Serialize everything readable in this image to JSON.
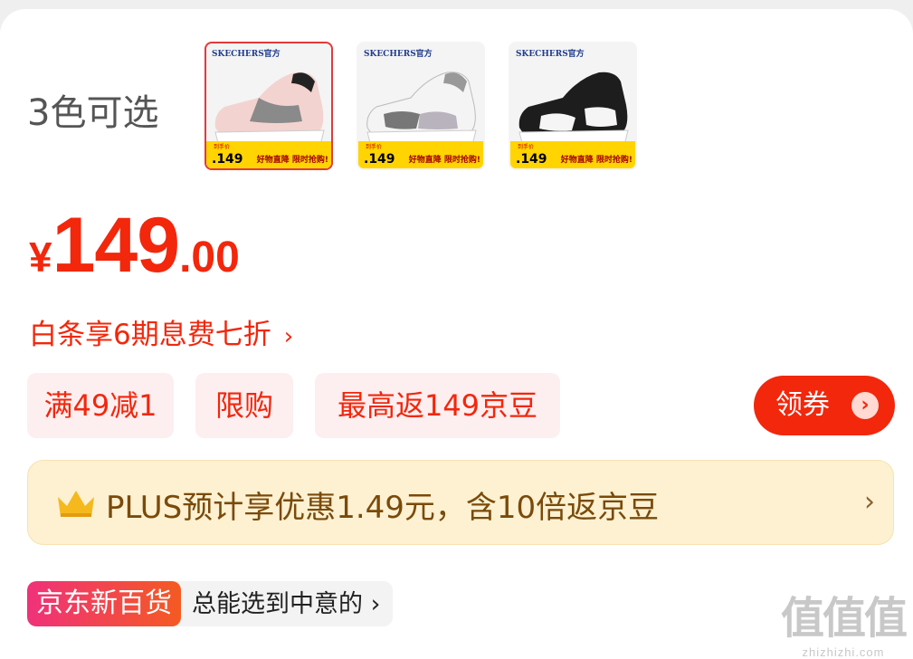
{
  "colors": {
    "label": "3色可选",
    "thumbs": [
      {
        "brand": "SKECHERS官方",
        "banner_price": ".149",
        "banner_text": "好物直降 限时抢购!",
        "banner_top": "到手价",
        "selected": true,
        "shoe": "pink-grey"
      },
      {
        "brand": "SKECHERS官方",
        "banner_price": ".149",
        "banner_text": "好物直降 限时抢购!",
        "banner_top": "到手价",
        "selected": false,
        "shoe": "white-grey"
      },
      {
        "brand": "SKECHERS官方",
        "banner_price": ".149",
        "banner_text": "好物直降 限时抢购!",
        "banner_top": "到手价",
        "selected": false,
        "shoe": "black-white"
      }
    ]
  },
  "price": {
    "symbol": "¥",
    "integer": "149",
    "decimal": ".00"
  },
  "baitiao": {
    "text": "白条享6期息费七折",
    "arrow": "›"
  },
  "tags": [
    "满49减1",
    "限购",
    "最高返149京豆"
  ],
  "coupon": {
    "label": "领券",
    "icon": "chevron-right-icon"
  },
  "plus": {
    "text": "PLUS预计享优惠1.49元，含10倍返京豆",
    "arrow": "›",
    "icon": "crown-icon"
  },
  "jd_new": {
    "badge": "京东新百货",
    "subtitle": "总能选到中意的 ›"
  },
  "watermark": {
    "big": "值值值",
    "small": "zhizhizhi.com"
  },
  "theme": {
    "accent": "#f2270c",
    "plus_bg": "#fdf1d2",
    "tag_bg": "#fdeef0"
  }
}
